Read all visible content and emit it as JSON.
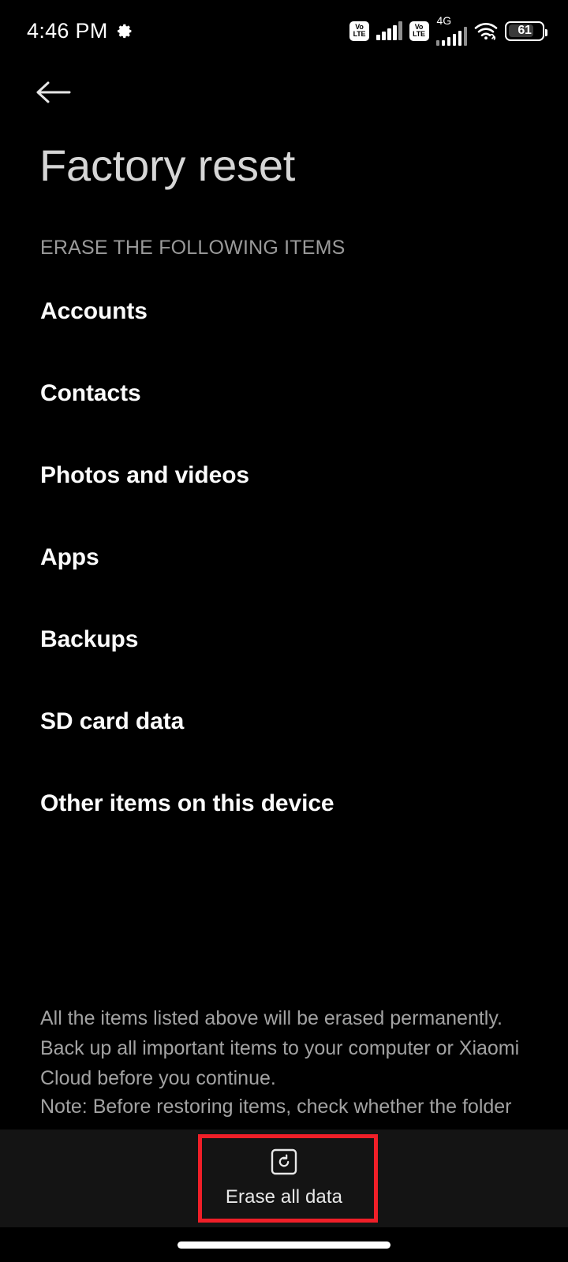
{
  "statusbar": {
    "time": "4:46 PM",
    "gear_icon": "gear-icon",
    "volte_top": "Vo",
    "volte_bottom": "LTE",
    "network_label": "4G",
    "wifi_icon": "wifi-icon",
    "battery_level": "61"
  },
  "header": {
    "back_icon": "back-arrow-icon",
    "title": "Factory reset",
    "section_label": "ERASE THE FOLLOWING ITEMS"
  },
  "list": {
    "items": [
      {
        "label": "Accounts"
      },
      {
        "label": "Contacts"
      },
      {
        "label": "Photos and videos"
      },
      {
        "label": "Apps"
      },
      {
        "label": "Backups"
      },
      {
        "label": "SD card data"
      },
      {
        "label": "Other items on this device"
      }
    ]
  },
  "footer": {
    "description": "All the items listed above will be erased permanently. Back up all important items to your computer or Xiaomi Cloud before you continue.",
    "note_truncated": "Note: Before restoring items, check whether the folder"
  },
  "action_bar": {
    "erase_icon": "reset-circular-arrow-icon",
    "erase_label": "Erase all data"
  },
  "navbar": {
    "home_indicator": "home-indicator-pill"
  },
  "colors": {
    "background": "#000000",
    "action_bar_bg": "#141414",
    "title_text": "#d6d6d6",
    "item_text": "#fbfbfb",
    "muted_text": "#a2a2a2",
    "highlight_red": "#f01f28"
  }
}
